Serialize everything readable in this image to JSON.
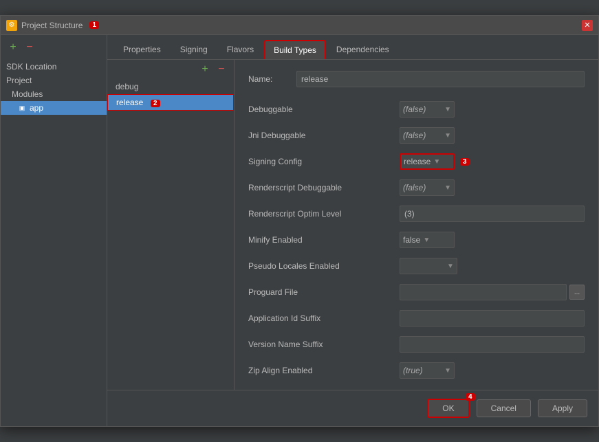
{
  "window": {
    "title": "Project Structure",
    "close_label": "✕",
    "badge_number": "1"
  },
  "sidebar": {
    "add_icon": "+",
    "minus_icon": "−",
    "items": [
      {
        "label": "SDK Location",
        "indent": 0
      },
      {
        "label": "Project",
        "indent": 0
      },
      {
        "label": "Modules",
        "indent": 1
      },
      {
        "label": "app",
        "indent": 2,
        "active": true
      }
    ]
  },
  "tabs": [
    {
      "label": "Properties",
      "active": false
    },
    {
      "label": "Signing",
      "active": false
    },
    {
      "label": "Flavors",
      "active": false
    },
    {
      "label": "Build Types",
      "active": true
    },
    {
      "label": "Dependencies",
      "active": false
    }
  ],
  "build_list": {
    "add_icon": "+",
    "minus_icon": "−",
    "items": [
      {
        "label": "debug"
      },
      {
        "label": "release",
        "selected": true
      }
    ],
    "badge_2": "2"
  },
  "form": {
    "name_label": "Name:",
    "name_value": "release",
    "fields": [
      {
        "label": "Debuggable",
        "type": "dropdown",
        "value": "(false)"
      },
      {
        "label": "Jni Debuggable",
        "type": "dropdown",
        "value": "(false)"
      },
      {
        "label": "Signing Config",
        "type": "dropdown_highlighted",
        "value": "release",
        "badge_3": "3"
      },
      {
        "label": "Renderscript Debuggable",
        "type": "dropdown",
        "value": "(false)"
      },
      {
        "label": "Renderscript Optim Level",
        "type": "text",
        "value": "(3)"
      },
      {
        "label": "Minify Enabled",
        "type": "dropdown",
        "value": "false"
      },
      {
        "label": "Pseudo Locales Enabled",
        "type": "dropdown",
        "value": ""
      },
      {
        "label": "Proguard File",
        "type": "proguard",
        "value": ""
      },
      {
        "label": "Application Id Suffix",
        "type": "text_input",
        "value": ""
      },
      {
        "label": "Version Name Suffix",
        "type": "text_input",
        "value": ""
      },
      {
        "label": "Zip Align Enabled",
        "type": "dropdown",
        "value": "(true)"
      }
    ]
  },
  "footer": {
    "ok_label": "OK",
    "cancel_label": "Cancel",
    "apply_label": "Apply",
    "badge_4": "4"
  }
}
